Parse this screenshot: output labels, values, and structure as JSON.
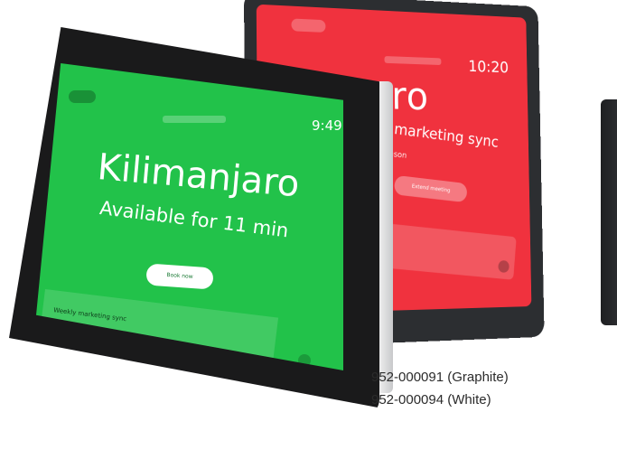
{
  "back_device": {
    "time": "10:20",
    "room_partial": "anjaro",
    "meeting_partial": "ekly marketing sync",
    "organizer_partial": "a Stevenson",
    "button_label": "Extend meeting",
    "colors": {
      "screen": "#f0323e",
      "shell": "#2c2e31"
    }
  },
  "front_device": {
    "time": "9:49",
    "room": "Kilimanjaro",
    "availability": "Available for 11 min",
    "button_label": "Book now",
    "next_meeting": "Weekly marketing sync",
    "colors": {
      "screen": "#22c24a",
      "shell": "#f4f4f4",
      "bezel": "#1a1a1b"
    }
  },
  "part_numbers": [
    "952-000091 (Graphite)",
    "952-000094 (White)"
  ]
}
